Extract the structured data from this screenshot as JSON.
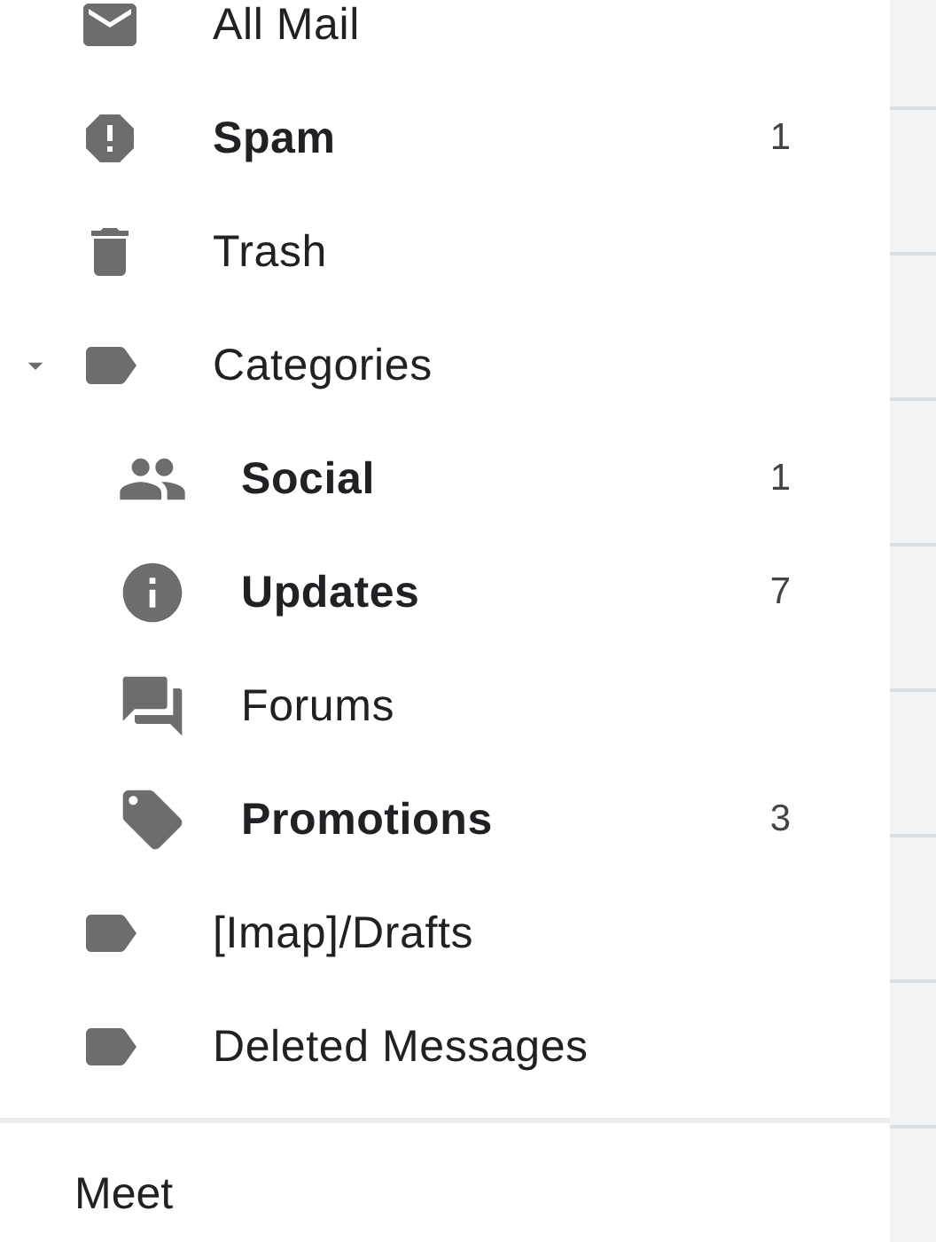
{
  "sidebar": {
    "items": [
      {
        "label": "All Mail",
        "unread": false
      },
      {
        "label": "Spam",
        "unread": true,
        "count": "1"
      },
      {
        "label": "Trash",
        "unread": false
      },
      {
        "label": "Categories",
        "unread": false,
        "expanded": true,
        "children": [
          {
            "label": "Social",
            "unread": true,
            "count": "1"
          },
          {
            "label": "Updates",
            "unread": true,
            "count": "7"
          },
          {
            "label": "Forums",
            "unread": false
          },
          {
            "label": "Promotions",
            "unread": true,
            "count": "3"
          }
        ]
      },
      {
        "label": "[Imap]/Drafts",
        "unread": false
      },
      {
        "label": "Deleted Messages",
        "unread": false
      }
    ]
  },
  "section": {
    "title": "Meet"
  }
}
